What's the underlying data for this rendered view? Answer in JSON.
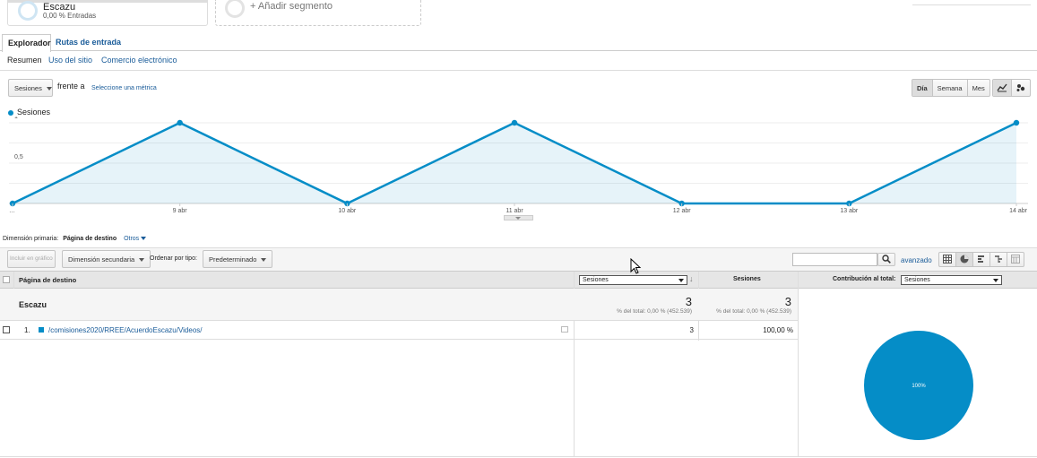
{
  "segments": {
    "active": {
      "title": "Escazu",
      "subtitle": "0,00 % Entradas",
      "color": "#8fc6e8"
    },
    "add_label": "+ Añadir segmento"
  },
  "tabs": [
    {
      "label": "Explorador",
      "active": true
    },
    {
      "label": "Rutas de entrada",
      "active": false
    }
  ],
  "subnav": [
    {
      "label": "Resumen",
      "active": true
    },
    {
      "label": "Uso del sitio",
      "active": false
    },
    {
      "label": "Comercio electrónico",
      "active": false
    }
  ],
  "controls": {
    "metric_select": "Sesiones",
    "versus_label": "frente a",
    "select_metric_link": "Seleccione una métrica",
    "granularity": [
      {
        "label": "Día",
        "active": true
      },
      {
        "label": "Semana",
        "active": false
      },
      {
        "label": "Mes",
        "active": false
      }
    ]
  },
  "chart_data": {
    "type": "line",
    "legend": [
      "Sesiones"
    ],
    "x": [
      "…",
      "9 abr",
      "10 abr",
      "11 abr",
      "12 abr",
      "13 abr",
      "14 abr"
    ],
    "series": [
      {
        "name": "Sesiones",
        "values": [
          0,
          1,
          0,
          1,
          0,
          0,
          1
        ]
      }
    ],
    "y_ticks": [
      "1",
      "0,5"
    ],
    "ylim": [
      0,
      1
    ],
    "grid": true,
    "color": "#058dc7"
  },
  "dimension": {
    "label": "Dimensión primaria:",
    "value": "Página de destino",
    "other": "Otros"
  },
  "toolbar": {
    "include_in_chart": "Incluir en gráfico",
    "secondary_dimension": "Dimensión secundaria",
    "sort_label": "Ordenar por tipo:",
    "sort_value": "Predeterminado",
    "search_placeholder": "",
    "advanced": "avanzado"
  },
  "table": {
    "col_page": "Página de destino",
    "col_metric_select": "Sesiones",
    "col_sessions": "Sesiones",
    "contribution_label": "Contribución al total:",
    "contribution_select": "Sesiones",
    "segment_row": {
      "name": "Escazu",
      "val1": "3",
      "val1_sub": "% del total: 0,00 % (452.539)",
      "val2": "3",
      "val2_sub": "% del total: 0,00 % (452.539)"
    },
    "rows": [
      {
        "index": "1.",
        "page": "/comisiones2020/RREE/AcuerdoEscazu/Videos/",
        "val1": "3",
        "val2": "100,00 %"
      }
    ]
  },
  "pie": {
    "label": "100%",
    "value": 100,
    "color": "#058dc7"
  }
}
